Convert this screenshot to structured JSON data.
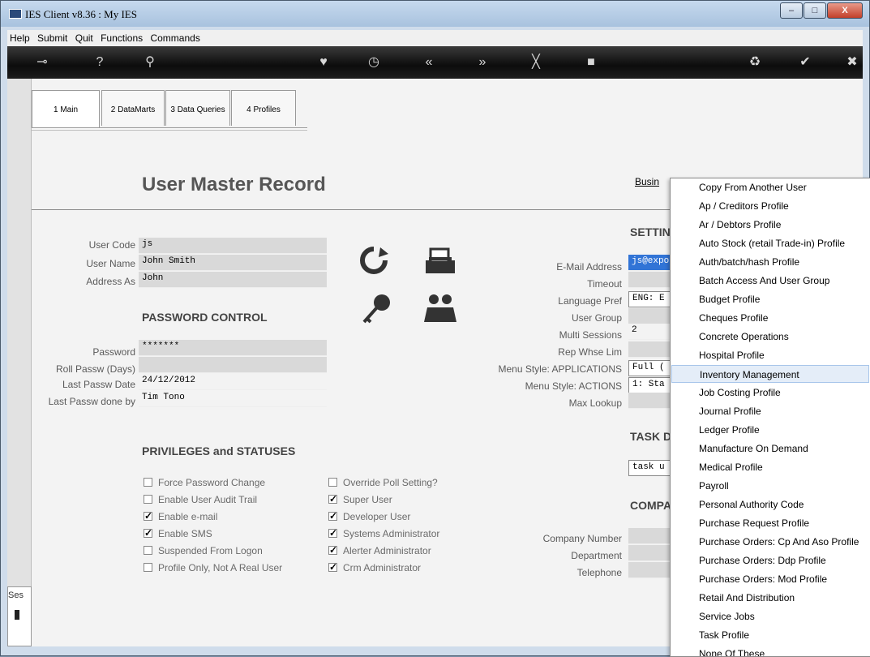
{
  "window": {
    "title": "IES Client v8.36 : My IES",
    "min": "–",
    "max": "□",
    "close": "X"
  },
  "menubar": [
    "Help",
    "Submit",
    "Quit",
    "Functions",
    "Commands"
  ],
  "tabs": [
    "1 Main",
    "2 DataMarts",
    "3 Data Queries",
    "4 Profiles"
  ],
  "page": {
    "title": "User Master Record",
    "link_text": "Busin"
  },
  "user": {
    "code_label": "User Code",
    "code": "js",
    "name_label": "User Name",
    "name": "John Smith",
    "address_label": "Address As",
    "address": "John"
  },
  "password": {
    "heading": "PASSWORD CONTROL",
    "password_label": "Password",
    "password": "*******",
    "roll_label": "Roll Passw (Days)",
    "roll": "",
    "last_date_label": "Last Passw Date",
    "last_date": "24/12/2012",
    "last_by_label": "Last Passw done by",
    "last_by": "Tim Tono"
  },
  "privileges": {
    "heading": "PRIVILEGES and STATUSES",
    "left": [
      {
        "label": "Force Password Change",
        "checked": false
      },
      {
        "label": "Enable User Audit Trail",
        "checked": false
      },
      {
        "label": "Enable e-mail",
        "checked": true
      },
      {
        "label": "Enable SMS",
        "checked": true
      },
      {
        "label": "Suspended From Logon",
        "checked": false
      },
      {
        "label": "Profile Only, Not A Real User",
        "checked": false
      }
    ],
    "right": [
      {
        "label": "Override Poll Setting?",
        "checked": false
      },
      {
        "label": "Super User",
        "checked": true
      },
      {
        "label": "Developer User",
        "checked": true
      },
      {
        "label": "Systems Administrator",
        "checked": true
      },
      {
        "label": "Alerter Administrator",
        "checked": true
      },
      {
        "label": "Crm Administrator",
        "checked": true
      }
    ]
  },
  "settings": {
    "heading": "SETTIN",
    "email_label": "E-Mail Address",
    "email": "js@expo",
    "timeout_label": "Timeout",
    "timeout": "",
    "lang_label": "Language Pref",
    "lang": "ENG: E",
    "group_label": "User Group",
    "group": "",
    "multi_label": "Multi Sessions",
    "multi": "2",
    "rep_label": "Rep Whse Lim",
    "rep": "",
    "menu_apps_label": "Menu Style: APPLICATIONS",
    "menu_apps": "Full (",
    "menu_actions_label": "Menu Style: ACTIONS",
    "menu_actions": "1: Sta",
    "max_label": "Max Lookup",
    "max": ""
  },
  "task": {
    "heading": "TASK D",
    "value": "task u"
  },
  "company": {
    "heading": "COMPA",
    "number_label": "Company Number",
    "number": "",
    "dept_label": "Department",
    "dept": "",
    "tel_label": "Telephone",
    "tel": ""
  },
  "side_label": "Ses",
  "popup": {
    "items": [
      "Copy From Another User",
      "Ap / Creditors Profile",
      "Ar / Debtors Profile",
      "Auto Stock (retail Trade-in) Profile",
      "Auth/batch/hash Profile",
      "Batch Access And User Group",
      "Budget Profile",
      "Cheques Profile",
      "Concrete Operations",
      "Hospital Profile",
      "Inventory Management",
      "Job Costing Profile",
      "Journal Profile",
      "Ledger Profile",
      "Manufacture On Demand",
      "Medical Profile",
      "Payroll",
      "Personal Authority Code",
      "Purchase Request Profile",
      "Purchase Orders: Cp And Aso Profile",
      "Purchase Orders: Ddp Profile",
      "Purchase Orders: Mod Profile",
      "Retail And Distribution",
      "Service Jobs",
      "Task Profile",
      "None Of These"
    ],
    "highlighted": "Inventory Management"
  }
}
